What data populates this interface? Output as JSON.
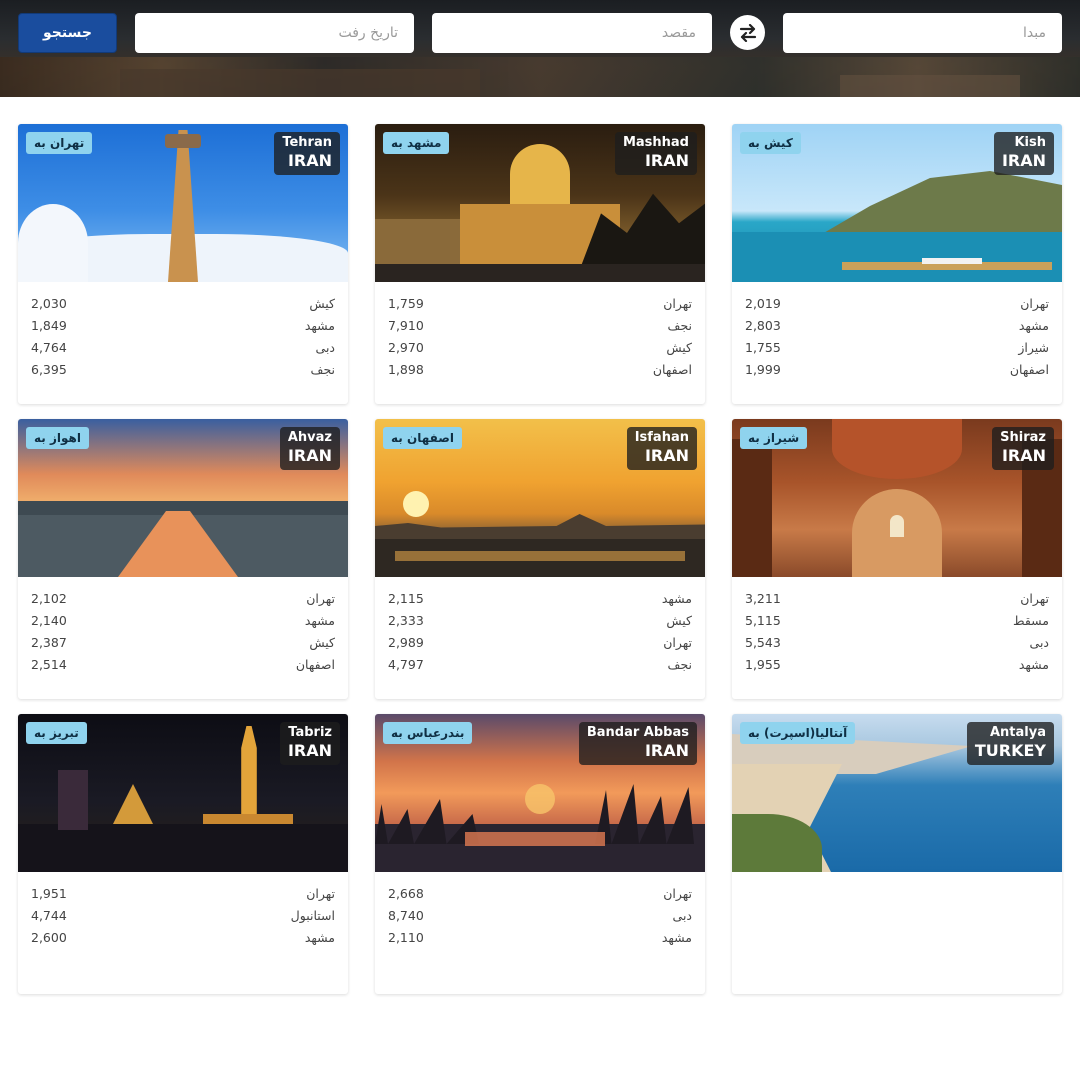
{
  "search": {
    "origin_placeholder": "مبدا",
    "destination_placeholder": "مقصد",
    "date_placeholder": "تاریخ رفت",
    "swap_icon": "swap-icon",
    "search_label": "جستجو"
  },
  "cards": [
    {
      "to_label": "کیش به",
      "city_en": "Kish",
      "country": "IRAN",
      "routes": [
        {
          "from": "تهران",
          "price": "2,019"
        },
        {
          "from": "مشهد",
          "price": "2,803"
        },
        {
          "from": "شیراز",
          "price": "1,755"
        },
        {
          "from": "اصفهان",
          "price": "1,999"
        }
      ]
    },
    {
      "to_label": "مشهد به",
      "city_en": "Mashhad",
      "country": "IRAN",
      "routes": [
        {
          "from": "تهران",
          "price": "1,759"
        },
        {
          "from": "نجف",
          "price": "7,910"
        },
        {
          "from": "کیش",
          "price": "2,970"
        },
        {
          "from": "اصفهان",
          "price": "1,898"
        }
      ]
    },
    {
      "to_label": "تهران به",
      "city_en": "Tehran",
      "country": "IRAN",
      "routes": [
        {
          "from": "کیش",
          "price": "2,030"
        },
        {
          "from": "مشهد",
          "price": "1,849"
        },
        {
          "from": "دبی",
          "price": "4,764"
        },
        {
          "from": "نجف",
          "price": "6,395"
        }
      ]
    },
    {
      "to_label": "شیراز به",
      "city_en": "Shiraz",
      "country": "IRAN",
      "routes": [
        {
          "from": "تهران",
          "price": "3,211"
        },
        {
          "from": "مسقط",
          "price": "5,115"
        },
        {
          "from": "دبی",
          "price": "5,543"
        },
        {
          "from": "مشهد",
          "price": "1,955"
        }
      ]
    },
    {
      "to_label": "اصفهان به",
      "city_en": "Isfahan",
      "country": "IRAN",
      "routes": [
        {
          "from": "مشهد",
          "price": "2,115"
        },
        {
          "from": "کیش",
          "price": "2,333"
        },
        {
          "from": "تهران",
          "price": "2,989"
        },
        {
          "from": "نجف",
          "price": "4,797"
        }
      ]
    },
    {
      "to_label": "اهواز به",
      "city_en": "Ahvaz",
      "country": "IRAN",
      "routes": [
        {
          "from": "تهران",
          "price": "2,102"
        },
        {
          "from": "مشهد",
          "price": "2,140"
        },
        {
          "from": "کیش",
          "price": "2,387"
        },
        {
          "from": "اصفهان",
          "price": "2,514"
        }
      ]
    },
    {
      "to_label": "آنتالیا(اسپرت) به",
      "city_en": "Antalya",
      "country": "TURKEY",
      "routes": []
    },
    {
      "to_label": "بندرعباس به",
      "city_en": "Bandar Abbas",
      "country": "IRAN",
      "routes": [
        {
          "from": "تهران",
          "price": "2,668"
        },
        {
          "from": "دبی",
          "price": "8,740"
        },
        {
          "from": "مشهد",
          "price": "2,110"
        }
      ]
    },
    {
      "to_label": "تبریز به",
      "city_en": "Tabriz",
      "country": "IRAN",
      "routes": [
        {
          "from": "تهران",
          "price": "1,951"
        },
        {
          "from": "استانبول",
          "price": "4,744"
        },
        {
          "from": "مشهد",
          "price": "2,600"
        }
      ]
    }
  ]
}
